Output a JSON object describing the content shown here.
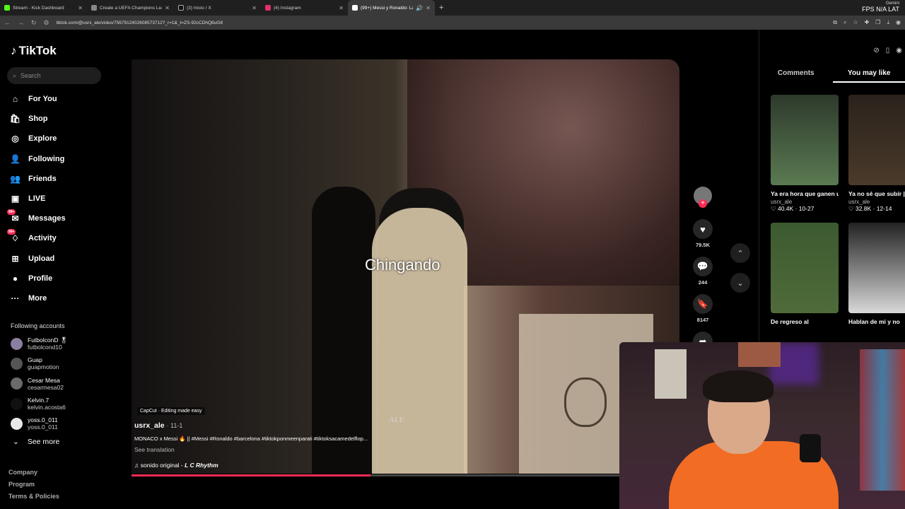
{
  "browser": {
    "tabs": [
      {
        "title": "Stream - Kick Dashboard",
        "color": "#53fc18"
      },
      {
        "title": "Create a UEFA Champions Lea",
        "color": "#888888"
      },
      {
        "title": "(3) Inicio / X",
        "color": "#ffffff"
      },
      {
        "title": "(4) Instagram",
        "color": "#e1306c"
      },
      {
        "title": "(99+) Messi y Ronaldo: La Ri",
        "color": "#ffffff",
        "active": true
      }
    ],
    "new_tab": "+",
    "url": "tiktok.com/@usrx_ale/video/7567912402608573712?_r=1&_t=ZS-92cCDhQ8uG8",
    "gemini": "Gemini",
    "fps_label": "FPS N/A",
    "lat_label": "LAT"
  },
  "sidebar": {
    "logo": "TikTok",
    "search_placeholder": "Search",
    "nav": [
      {
        "label": "For You",
        "icon": "⌂"
      },
      {
        "label": "Shop",
        "icon": "🛍"
      },
      {
        "label": "Explore",
        "icon": "◎"
      },
      {
        "label": "Following",
        "icon": "👤"
      },
      {
        "label": "Friends",
        "icon": "👥"
      },
      {
        "label": "LIVE",
        "icon": "▣"
      },
      {
        "label": "Messages",
        "icon": "✉",
        "badge": "99+"
      },
      {
        "label": "Activity",
        "icon": "♢",
        "badge": "99+"
      },
      {
        "label": "Upload",
        "icon": "⊞"
      },
      {
        "label": "Profile",
        "icon": "●"
      },
      {
        "label": "More",
        "icon": "···"
      }
    ],
    "following_title": "Following accounts",
    "accounts": [
      {
        "name": "FutbolconD 🎖",
        "handle": "futbolcond10"
      },
      {
        "name": "Guap",
        "handle": "guapmotion"
      },
      {
        "name": "Cesar Mesa",
        "handle": "cesarmesa02"
      },
      {
        "name": "Kelvin.7",
        "handle": "kelvin.acosta6"
      },
      {
        "name": "yoss.0_011",
        "handle": "yoss.0_011"
      }
    ],
    "see_more": "See more",
    "footer": [
      "Company",
      "Program",
      "Terms & Policies"
    ]
  },
  "video": {
    "overlay_text": "Chingando",
    "watermark": "ALE",
    "capcut": "CapCut · Editing made easy",
    "author": "usrx_ale",
    "date": "· 11-1",
    "description": "MONACO x Messi 🔥 || #Messi #Ronaldo #barcelona #tiktokponmeenparati #tiktoksacamedelflop...",
    "see_translation": "See translation",
    "sound_prefix": "sonido original - ",
    "sound_author": "L C Rhythm",
    "progress": 0.49,
    "likes": "79.5K",
    "comments": "244",
    "saves": "8147"
  },
  "right_panel": {
    "tabs": [
      "Comments",
      "You may like"
    ],
    "cards": [
      {
        "title": "Ya era hora que ganen uno 🥵||...",
        "user": "usrx_ale",
        "stats": "♡ 40.4K · 10-27",
        "color": "#5a7a52"
      },
      {
        "title": "Ya no sé que subir || #fyp #yamal...",
        "user": "usrx_ale",
        "stats": "♡ 32.8K · 12-14",
        "color": "#4a3a2a"
      },
      {
        "title": "De regreso al",
        "user": "",
        "stats": "",
        "color": "#4f6b3a"
      },
      {
        "title": "Hablan de mi y no",
        "user": "",
        "stats": "",
        "color": "#d8d8d8"
      }
    ]
  }
}
